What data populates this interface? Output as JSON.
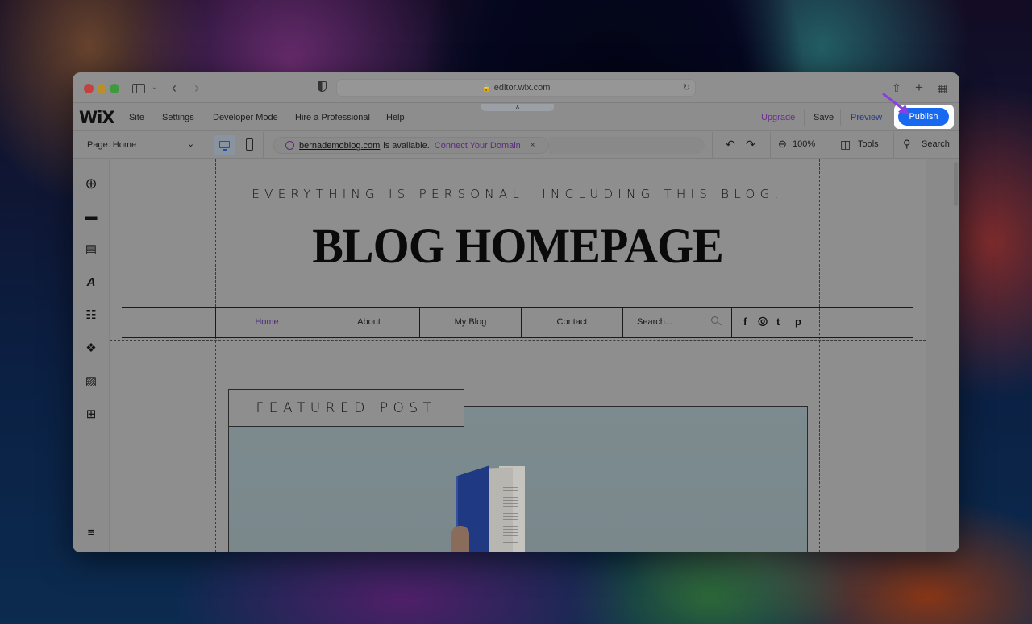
{
  "browser": {
    "url": "editor.wix.com"
  },
  "wix_topbar": {
    "logo": "WiX",
    "menu": [
      "Site",
      "Settings",
      "Developer Mode",
      "Hire a Professional",
      "Help"
    ],
    "collapse_glyph": "˄",
    "upgrade_label": "Upgrade",
    "save_label": "Save",
    "preview_label": "Preview",
    "publish_label": "Publish",
    "publish_color": "#1769f0"
  },
  "wix_toolbar": {
    "page_label": "Page: Home",
    "domain": "bernademoblog.com",
    "domain_status": "is available.",
    "connect_label": "Connect Your Domain",
    "dismiss_glyph": "×",
    "zoom_level": "100%",
    "tools_label": "Tools",
    "search_label": "Search"
  },
  "left_panel": {
    "items": [
      {
        "name": "add-elements",
        "glyph": "⊕"
      },
      {
        "name": "add-section",
        "glyph": "▬"
      },
      {
        "name": "pages-menu",
        "glyph": "▤"
      },
      {
        "name": "site-design",
        "glyph": "A"
      },
      {
        "name": "add-apps",
        "glyph": "☷"
      },
      {
        "name": "business-apps",
        "glyph": "❖"
      },
      {
        "name": "media",
        "glyph": "▨"
      },
      {
        "name": "cms",
        "glyph": "⊞"
      }
    ],
    "layers_glyph": "≡"
  },
  "site": {
    "tagline": "EVERYTHING IS PERSONAL. INCLUDING THIS BLOG.",
    "title": "BLOG HOMEPAGE",
    "nav": [
      "Home",
      "About",
      "My Blog",
      "Contact"
    ],
    "active_nav": "Home",
    "search_placeholder": "Search...",
    "social": [
      "f",
      "◎",
      "t",
      "p"
    ],
    "featured_label": "FEATURED POST"
  }
}
